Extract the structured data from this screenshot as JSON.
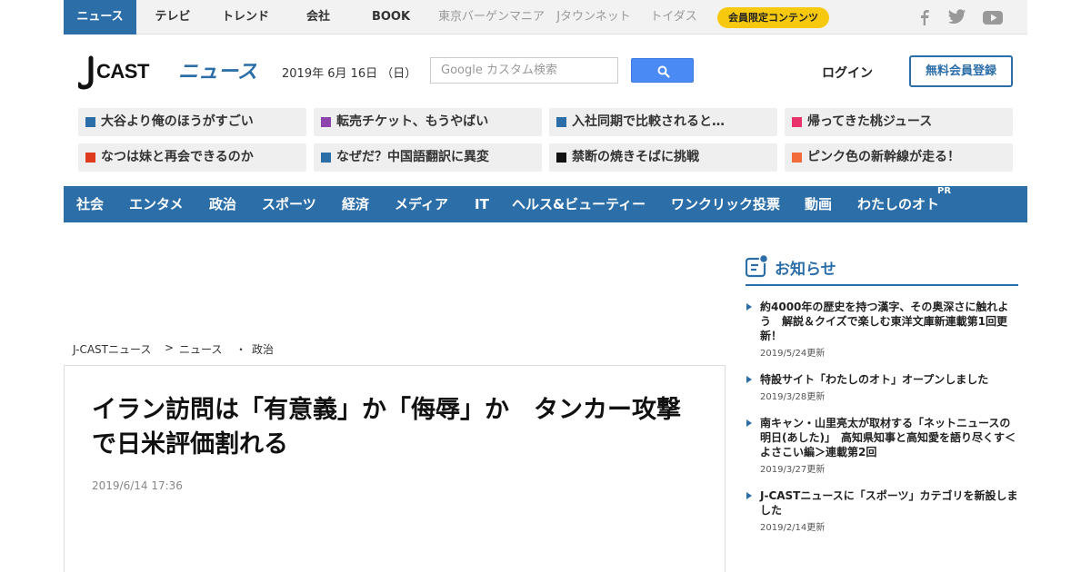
{
  "topnav": {
    "items": [
      {
        "label": "ニュース",
        "active": true
      },
      {
        "label": "テレビ"
      },
      {
        "label": "トレンド"
      },
      {
        "label": "会社"
      },
      {
        "label": "BOOK"
      },
      {
        "label": "東京バーゲンマニア",
        "muted": true
      },
      {
        "label": "Jタウンネット",
        "muted": true
      },
      {
        "label": "トイダス",
        "muted": true
      }
    ],
    "member_label": "会員限定コンテンツ",
    "social": [
      "facebook-icon",
      "twitter-icon",
      "youtube-icon"
    ]
  },
  "header": {
    "logo_text": "J-CAST ニュース",
    "date": "2019年 6月 16日 （日）",
    "search_placeholder": "Google カスタム検索",
    "login_label": "ログイン",
    "register_label": "無料会員登録"
  },
  "topics": [
    {
      "label": "大谷より俺のほうがすごい",
      "color": "#2c6ea8"
    },
    {
      "label": "転売チケット、もうやばい",
      "color": "#8e44ad"
    },
    {
      "label": "入社同期で比較されると…",
      "color": "#2c6ea8"
    },
    {
      "label": "帰ってきた桃ジュース",
      "color": "#e8336b"
    },
    {
      "label": "なつは妹と再会できるのか",
      "color": "#e03a1e"
    },
    {
      "label": "なぜだ？中国語翻訳に異変",
      "color": "#2c6ea8"
    },
    {
      "label": "禁断の焼きそばに挑戦",
      "color": "#111111"
    },
    {
      "label": "ピンク色の新幹線が走る！",
      "color": "#f26b3a"
    }
  ],
  "categories": [
    "社会",
    "エンタメ",
    "政治",
    "スポーツ",
    "経済",
    "メディア",
    "IT",
    "ヘルス&ビューティー",
    "ワンクリック投票",
    "動画",
    "わたしのオト"
  ],
  "pr_label": "PR",
  "breadcrumb": [
    "J-CASTニュース",
    ">",
    "ニュース",
    "・",
    "政治"
  ],
  "article": {
    "title": "イラン訪問は「有意義」か「侮辱」か　タンカー攻撃で日米評価割れる",
    "date": "2019/6/14 17:36"
  },
  "notice": {
    "heading": "お知らせ",
    "items": [
      {
        "title": "約4000年の歴史を持つ漢字、その奥深さに触れよう　解説＆クイズで楽しむ東洋文庫新連載第1回更新！",
        "date": "2019/5/24更新"
      },
      {
        "title": "特設サイト「わたしのオト」オープンしました",
        "date": "2019/3/28更新"
      },
      {
        "title": "南キャン・山里亮太が取材する「ネットニュースの明日(あした)」　高知県知事と高知愛を語り尽くす＜よさこい編＞連載第2回",
        "date": "2019/3/27更新"
      },
      {
        "title": "J-CASTニュースに「スポーツ」カテゴリを新設しました",
        "date": "2019/2/14更新"
      }
    ]
  },
  "colors": {
    "brand": "#2c6ea8",
    "member_badge": "#f6c90e",
    "search_button": "#4a8af4"
  }
}
